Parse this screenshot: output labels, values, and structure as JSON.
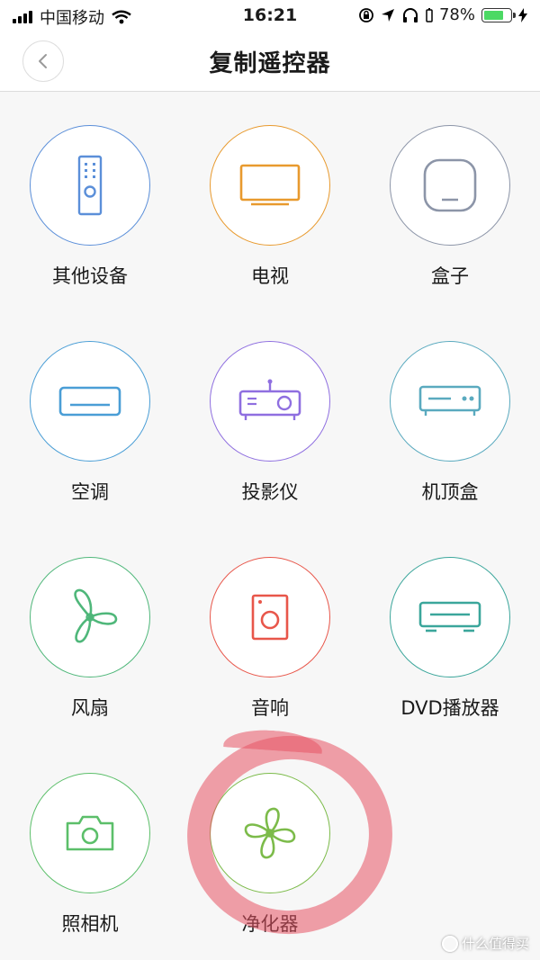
{
  "status_bar": {
    "carrier": "中国移动",
    "time": "16:21",
    "battery_percent": "78%",
    "battery_level": 0.78,
    "battery_color": "#4cd964",
    "icons": [
      "signal-icon",
      "wifi-icon",
      "rotation-lock-icon",
      "location-icon",
      "headphones-icon",
      "battery-icon",
      "charging-icon"
    ]
  },
  "nav": {
    "title": "复制遥控器",
    "back_icon": "chevron-left-icon"
  },
  "devices": [
    {
      "label": "其他设备",
      "icon": "remote-control-icon",
      "color": "#5b8fd9"
    },
    {
      "label": "电视",
      "icon": "tv-icon",
      "color": "#e89a2e"
    },
    {
      "label": "盒子",
      "icon": "box-icon",
      "color": "#8c95a8"
    },
    {
      "label": "空调",
      "icon": "air-conditioner-icon",
      "color": "#4a9ed6"
    },
    {
      "label": "投影仪",
      "icon": "projector-icon",
      "color": "#8f6fe0"
    },
    {
      "label": "机顶盒",
      "icon": "set-top-box-icon",
      "color": "#5aaabf"
    },
    {
      "label": "风扇",
      "icon": "fan-icon",
      "color": "#4fb77a"
    },
    {
      "label": "音响",
      "icon": "speaker-icon",
      "color": "#e8564a"
    },
    {
      "label": "DVD播放器",
      "icon": "dvd-player-icon",
      "color": "#3ba69b"
    },
    {
      "label": "照相机",
      "icon": "camera-icon",
      "color": "#5cbf6a"
    },
    {
      "label": "净化器",
      "icon": "purifier-icon",
      "color": "#7cbb4a"
    }
  ],
  "annotation": {
    "color": "#e85464"
  },
  "watermark": "什么值得买"
}
